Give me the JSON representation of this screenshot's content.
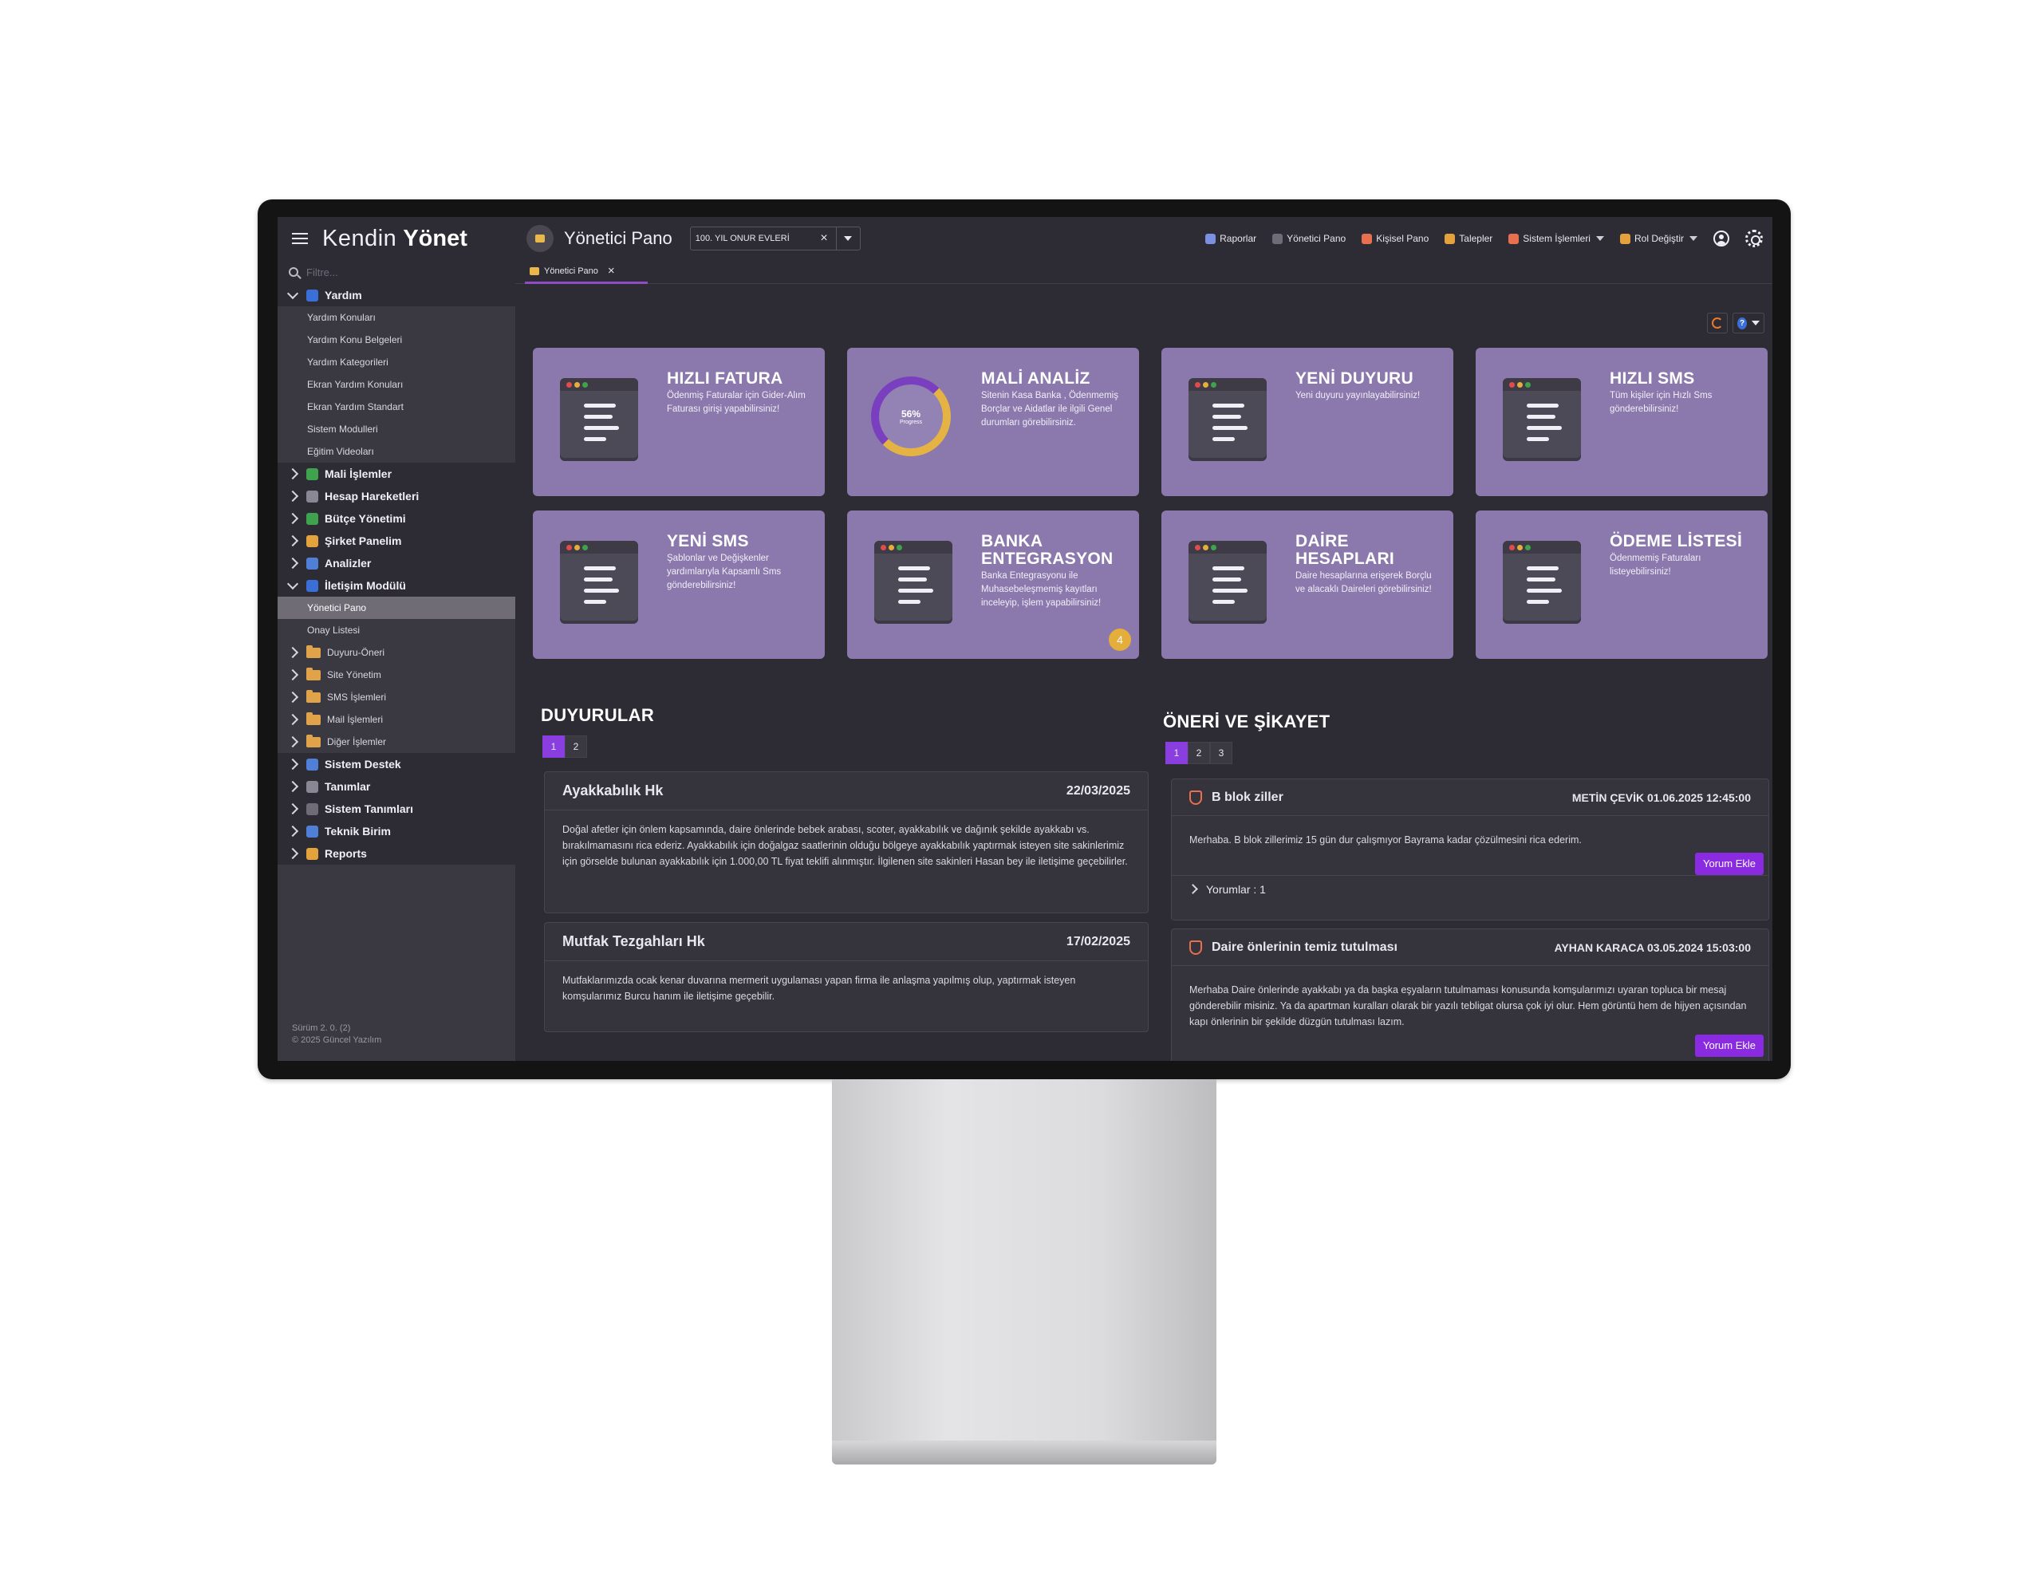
{
  "brand": {
    "part1": "Kendin",
    "part2": "Yönet"
  },
  "filter_placeholder": "Filtre...",
  "sidebar": {
    "items": [
      {
        "label": "Yardım",
        "kind": "top",
        "open": true,
        "color": "#3b6fd8"
      },
      {
        "label": "Yardım Konuları",
        "kind": "sub"
      },
      {
        "label": "Yardım Konu Belgeleri",
        "kind": "sub"
      },
      {
        "label": "Yardım Kategorileri",
        "kind": "sub"
      },
      {
        "label": "Ekran Yardım Konuları",
        "kind": "sub"
      },
      {
        "label": "Ekran Yardım Standart",
        "kind": "sub"
      },
      {
        "label": "Sistem Modulleri",
        "kind": "sub"
      },
      {
        "label": "Eğitim Videoları",
        "kind": "sub"
      },
      {
        "label": "Mali İşlemler",
        "kind": "top",
        "color": "#3fa34d"
      },
      {
        "label": "Hesap Hareketleri",
        "kind": "top",
        "color": "#8a8795"
      },
      {
        "label": "Bütçe Yönetimi",
        "kind": "top",
        "color": "#3fa34d"
      },
      {
        "label": "Şirket Panelim",
        "kind": "top",
        "color": "#e3a23c"
      },
      {
        "label": "Analizler",
        "kind": "top",
        "color": "#4f7fd6"
      },
      {
        "label": "İletişim Modülü",
        "kind": "top",
        "open": true,
        "color": "#3b6fd8"
      },
      {
        "label": "Yönetici Pano",
        "kind": "sub",
        "active": true
      },
      {
        "label": "Onay Listesi",
        "kind": "sub"
      },
      {
        "label": "Duyuru-Öneri",
        "kind": "folder"
      },
      {
        "label": "Site Yönetim",
        "kind": "folder"
      },
      {
        "label": "SMS İşlemleri",
        "kind": "folder"
      },
      {
        "label": "Mail İşlemleri",
        "kind": "folder"
      },
      {
        "label": "Diğer İşlemler",
        "kind": "folder"
      },
      {
        "label": "Sistem Destek",
        "kind": "top",
        "color": "#4f7fd6"
      },
      {
        "label": "Tanımlar",
        "kind": "top",
        "color": "#8a8795"
      },
      {
        "label": "Sistem Tanımları",
        "kind": "top",
        "color": "#6f6c78"
      },
      {
        "label": "Teknik Birim",
        "kind": "top",
        "color": "#4f7fd6"
      },
      {
        "label": "Reports",
        "kind": "top",
        "color": "#e3a23c"
      }
    ]
  },
  "version": {
    "line1": "Sürüm 2. 0. (2)",
    "line2": "© 2025 Güncel Yazılım"
  },
  "topbar": {
    "title": "Yönetici Pano",
    "site": "100. YIL ONUR EVLERİ",
    "nav": [
      {
        "label": "Raporlar",
        "color": "#7d8fe0",
        "dropdown": false
      },
      {
        "label": "Yönetici Pano",
        "color": "#6f6c78",
        "dropdown": false
      },
      {
        "label": "Kişisel Pano",
        "color": "#e8704f",
        "dropdown": false
      },
      {
        "label": "Talepler",
        "color": "#e3a23c",
        "dropdown": false
      },
      {
        "label": "Sistem İşlemleri",
        "color": "#e8704f",
        "dropdown": true
      },
      {
        "label": "Rol Değiştir",
        "color": "#e3a23c",
        "dropdown": true
      }
    ]
  },
  "tab": {
    "label": "Yönetici Pano"
  },
  "cards": [
    {
      "title": "HIZLI FATURA",
      "text": "Ödenmiş Faturalar için Gider-Alım Faturası girişi yapabilirsiniz!",
      "icon": "invoice-window-icon"
    },
    {
      "title": "MALİ ANALİZ",
      "text": "Sitenin Kasa Banka , Ödenmemiş Borçlar ve Aidatlar ile ilgili Genel durumları görebilirsiniz.",
      "icon": "progress-ring-icon",
      "ring_value": "56%",
      "ring_label": "Progress"
    },
    {
      "title": "YENİ DUYURU",
      "text": "Yeni duyuru yayınlayabilirsiniz!",
      "icon": "announcement-window-icon"
    },
    {
      "title": "HIZLI SMS",
      "text": "Tüm kişiler için Hızlı Sms gönderebilirsiniz!",
      "icon": "checklist-icon"
    },
    {
      "title": "YENİ SMS",
      "text": "Şablonlar ve Değişkenler yardımlarıyla Kapsamlı Sms gönderebilirsiniz!",
      "icon": "checklist-icon"
    },
    {
      "title": "BANKA ENTEGRASYON",
      "text": "Banka Entegrasyonu ile Muhasebeleşmemiş kayıtları inceleyip, işlem yapabilirsiniz!",
      "icon": "bank-sync-icon",
      "badge": "4"
    },
    {
      "title": "DAİRE HESAPLARI",
      "text": "Daire hesaplarına erişerek Borçlu ve alacaklı Daireleri görebilirsiniz!",
      "icon": "sum-sheet-icon"
    },
    {
      "title": "ÖDEME LİSTESİ",
      "text": "Ödenmemiş Faturaları listeyebilirsiniz!",
      "icon": "payment-sheet-icon"
    }
  ],
  "announcements": {
    "title": "DUYURULAR",
    "pages": [
      "1",
      "2"
    ],
    "items": [
      {
        "title": "Ayakkabılık Hk",
        "date": "22/03/2025",
        "body": "Doğal afetler için önlem kapsamında, daire önlerinde bebek arabası, scoter, ayakkabılık ve dağınık şekilde ayakkabı vs. bırakılmamasını rica ederiz. Ayakkabılık için doğalgaz saatlerinin olduğu bölgeye ayakkabılık yaptırmak isteyen site sakinlerimiz için görselde bulunan ayakkabılık için 1.000,00 TL fiyat teklifi alınmıştır. İlgilenen site sakinleri Hasan bey ile iletişime geçebilirler."
      },
      {
        "title": "Mutfak Tezgahları Hk",
        "date": "17/02/2025",
        "body": "Mutfaklarımızda ocak kenar duvarına mermerit uygulaması yapan firma ile anlaşma yapılmış olup, yaptırmak isteyen komşularımız Burcu hanım ile iletişime geçebilir."
      }
    ]
  },
  "complaints": {
    "title": "ÖNERİ VE ŞİKAYET",
    "pages": [
      "1",
      "2",
      "3"
    ],
    "add_label": "Yorum Ekle",
    "items": [
      {
        "title": "B blok ziller",
        "author": "METİN ÇEVİK 01.06.2025 12:45:00",
        "body": "Merhaba. B blok zillerimiz 15 gün dur çalışmıyor Bayrama kadar çözülmesini rica ederim.",
        "comments": "Yorumlar : 1"
      },
      {
        "title": "Daire önlerinin temiz tutulması",
        "author": "AYHAN KARACA 03.05.2024 15:03:00",
        "body": "Merhaba Daire önlerinde ayakkabı ya da başka eşyaların tutulmaması konusunda komşularımızı uyaran topluca bir mesaj gönderebilir misiniz. Ya da apartman kuralları olarak bir yazılı tebligat olursa çok iyi olur. Hem görüntü hem de hijyen açısından kapı önlerinin bir şekilde düzgün tutulması lazım."
      }
    ]
  }
}
